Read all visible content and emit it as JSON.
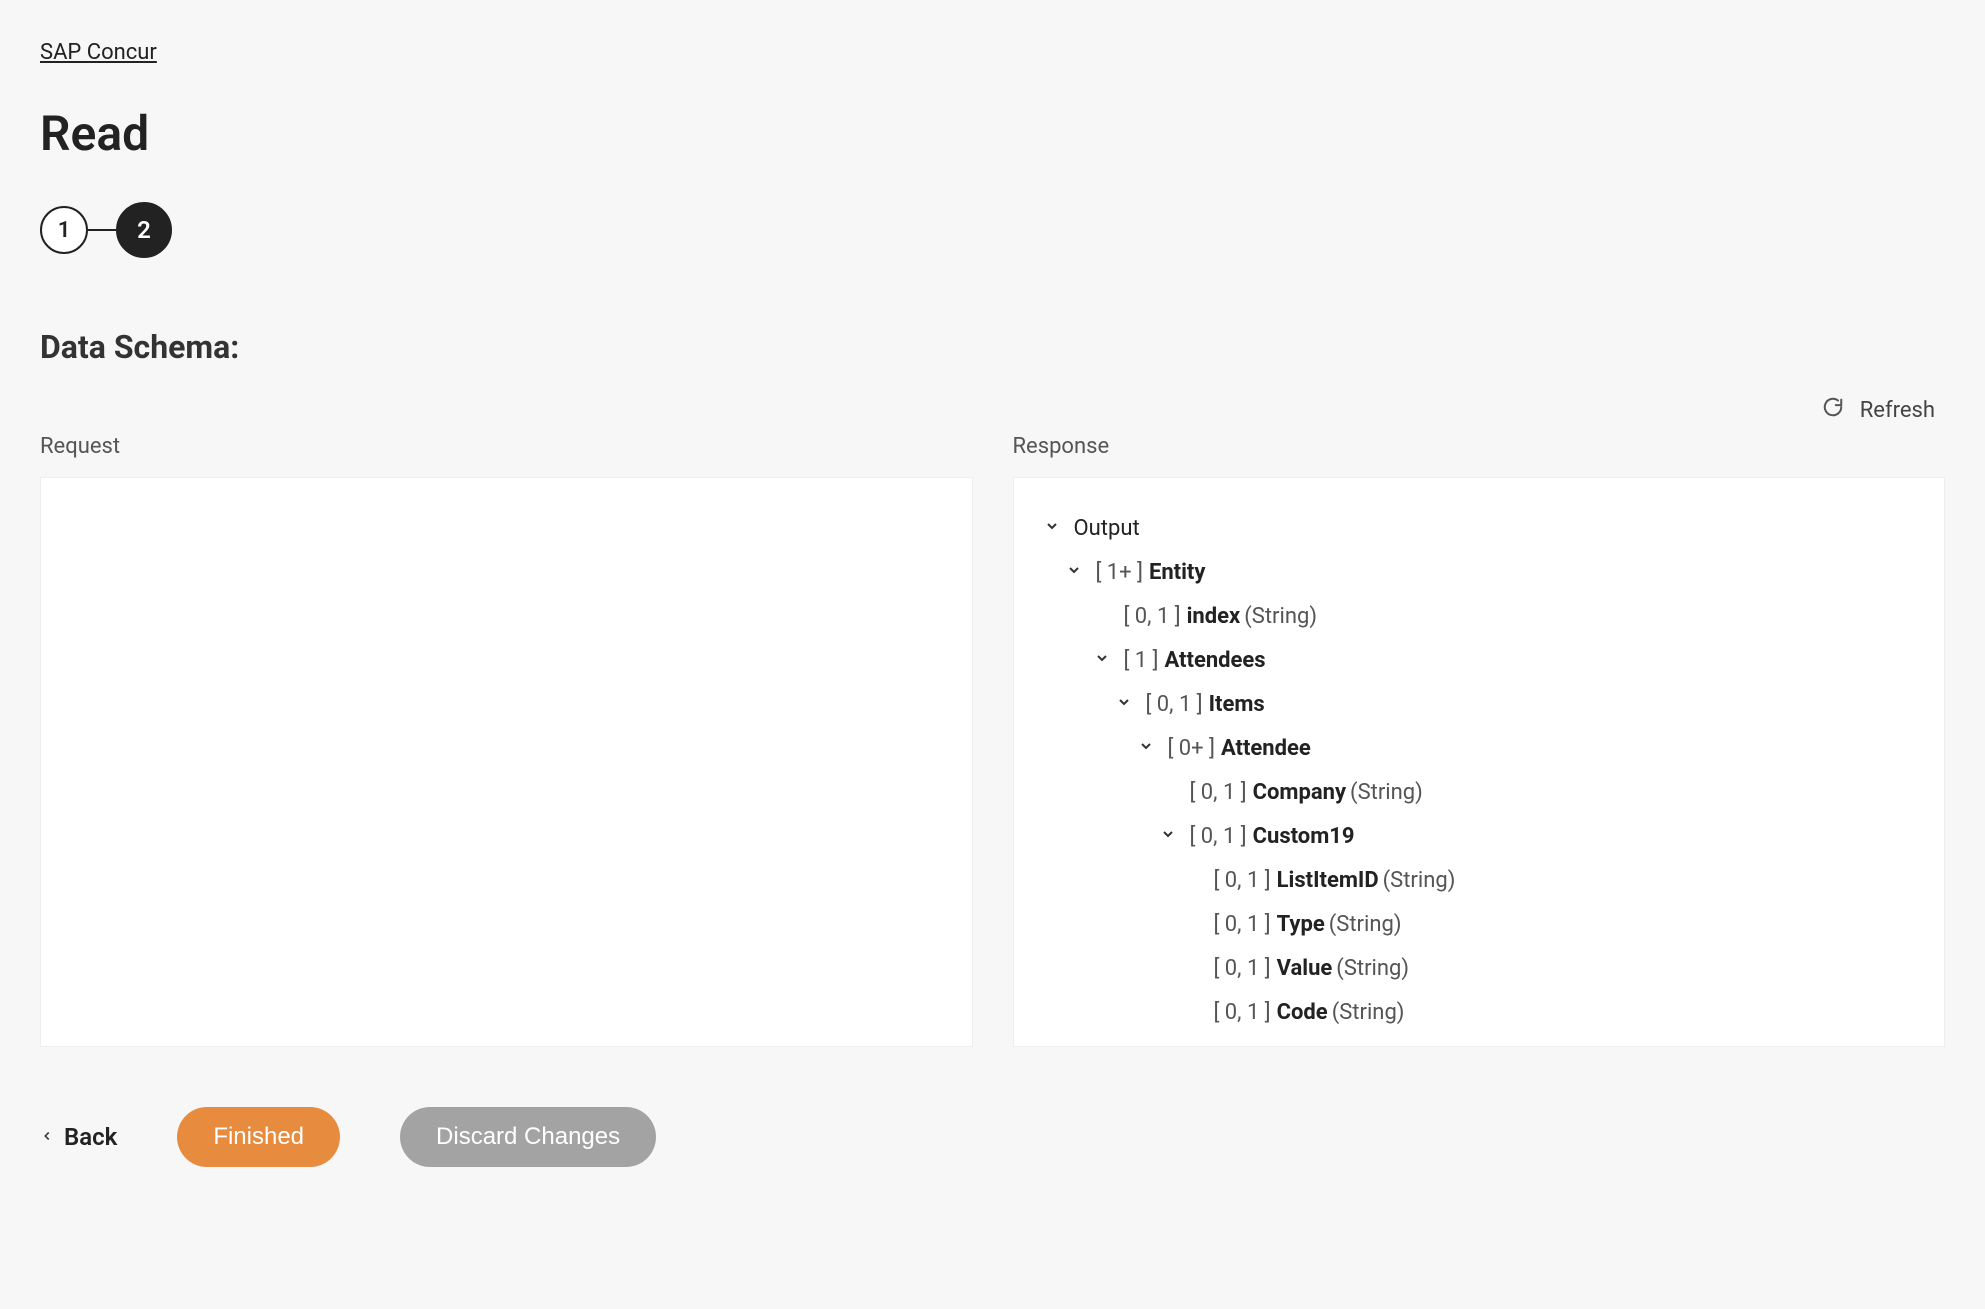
{
  "breadcrumb": {
    "label": "SAP Concur"
  },
  "page": {
    "title": "Read"
  },
  "stepper": {
    "step1": "1",
    "step2": "2"
  },
  "section": {
    "title": "Data Schema:"
  },
  "actions": {
    "refresh": "Refresh"
  },
  "panels": {
    "request_label": "Request",
    "response_label": "Response"
  },
  "tree": {
    "output": {
      "label": "Output"
    },
    "entity": {
      "card": "[ 1+ ]",
      "name": "Entity"
    },
    "index": {
      "card": "[ 0, 1 ]",
      "name": "index",
      "type": "(String)"
    },
    "attendees": {
      "card": "[ 1 ]",
      "name": "Attendees"
    },
    "items": {
      "card": "[ 0, 1 ]",
      "name": "Items"
    },
    "attendee": {
      "card": "[ 0+ ]",
      "name": "Attendee"
    },
    "company": {
      "card": "[ 0, 1 ]",
      "name": "Company",
      "type": "(String)"
    },
    "custom19": {
      "card": "[ 0, 1 ]",
      "name": "Custom19"
    },
    "listitemid": {
      "card": "[ 0, 1 ]",
      "name": "ListItemID",
      "type": "(String)"
    },
    "type_": {
      "card": "[ 0, 1 ]",
      "name": "Type",
      "type": "(String)"
    },
    "value": {
      "card": "[ 0, 1 ]",
      "name": "Value",
      "type": "(String)"
    },
    "code": {
      "card": "[ 0, 1 ]",
      "name": "Code",
      "type": "(String)"
    }
  },
  "footer": {
    "back": "Back",
    "finished": "Finished",
    "discard": "Discard Changes"
  }
}
